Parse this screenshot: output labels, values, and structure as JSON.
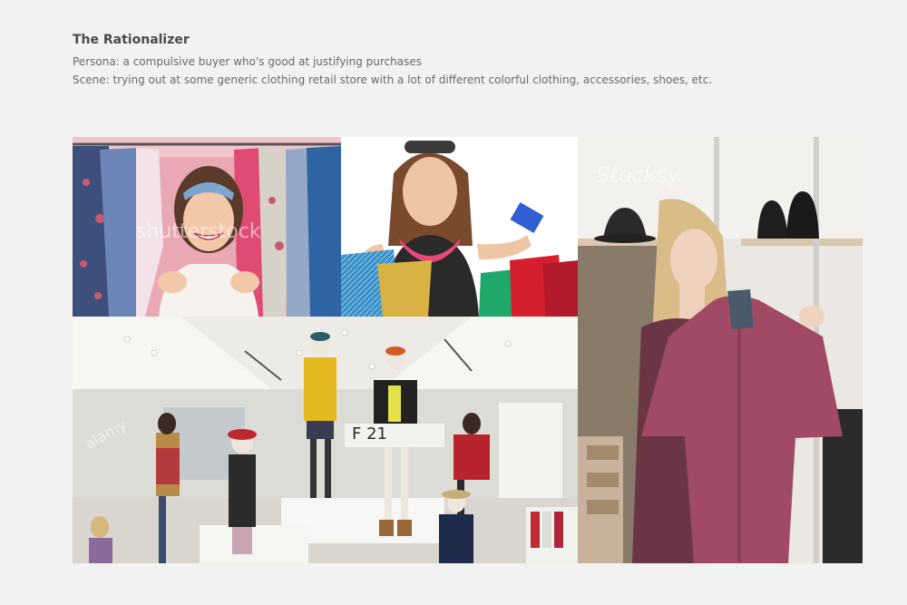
{
  "header": {
    "title": "The Rationalizer",
    "persona": "Persona: a compulsive buyer who's good at justifying purchases",
    "scene": "Scene: trying out at some generic clothing retail store with a lot of different colorful clothing, accessories, shoes, etc."
  },
  "photos": {
    "clothes_rack": {
      "watermark": "shutterstock"
    },
    "shopping_bags": {},
    "store_interior": {
      "watermark": "alamy",
      "sign": "F 21"
    },
    "coat_tryon": {
      "watermark": "Stocksy"
    }
  }
}
